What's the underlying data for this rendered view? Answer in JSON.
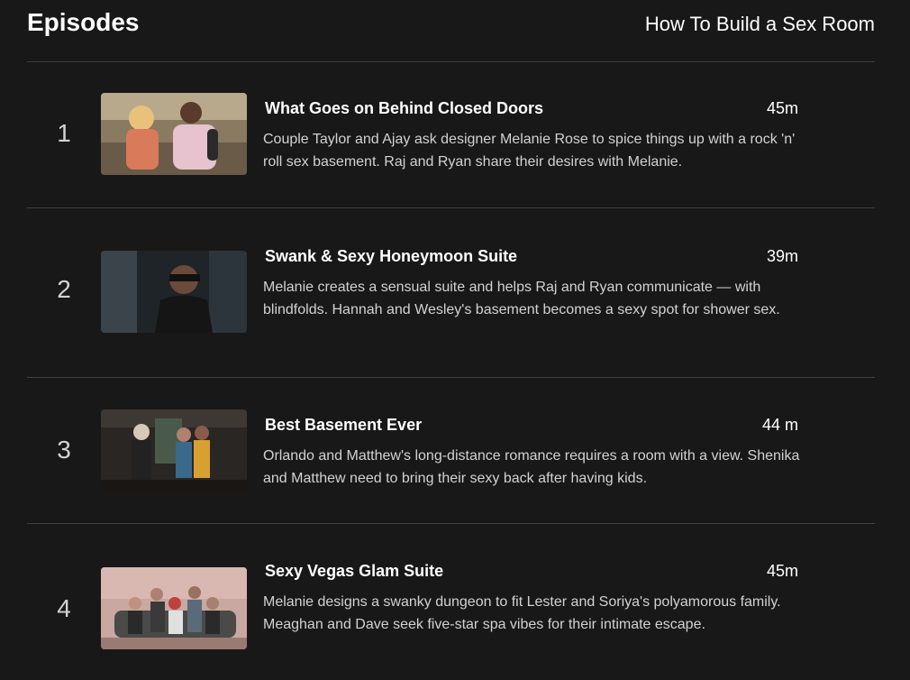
{
  "header": {
    "title": "Episodes",
    "show_title": "How To Build a Sex Room"
  },
  "episodes": [
    {
      "index": "1",
      "title": "What Goes on Behind Closed Doors",
      "duration": "45m",
      "description": "Couple Taylor and Ajay ask designer Melanie Rose to spice things up with a rock 'n' roll sex basement. Raj and Ryan share their desires with Melanie."
    },
    {
      "index": "2",
      "title": "Swank & Sexy Honeymoon Suite",
      "duration": "39m",
      "description": "Melanie creates a sensual suite and helps Raj and Ryan communicate — with blindfolds. Hannah and Wesley's basement becomes a sexy spot for shower sex."
    },
    {
      "index": "3",
      "title": "Best Basement Ever",
      "duration": "44 m",
      "description": "Orlando and Matthew's long-distance romance requires a room with a view. Shenika and Matthew need to bring their sexy back after having kids."
    },
    {
      "index": "4",
      "title": "Sexy Vegas Glam Suite",
      "duration": "45m",
      "description": "Melanie designs a swanky dungeon to fit Lester and Soriya's polyamorous family. Meaghan and Dave seek five-star spa vibes for their intimate escape."
    }
  ],
  "colors": {
    "background": "#181818",
    "divider": "#404040",
    "text_primary": "#ffffff",
    "text_secondary": "#d2d2d2"
  }
}
